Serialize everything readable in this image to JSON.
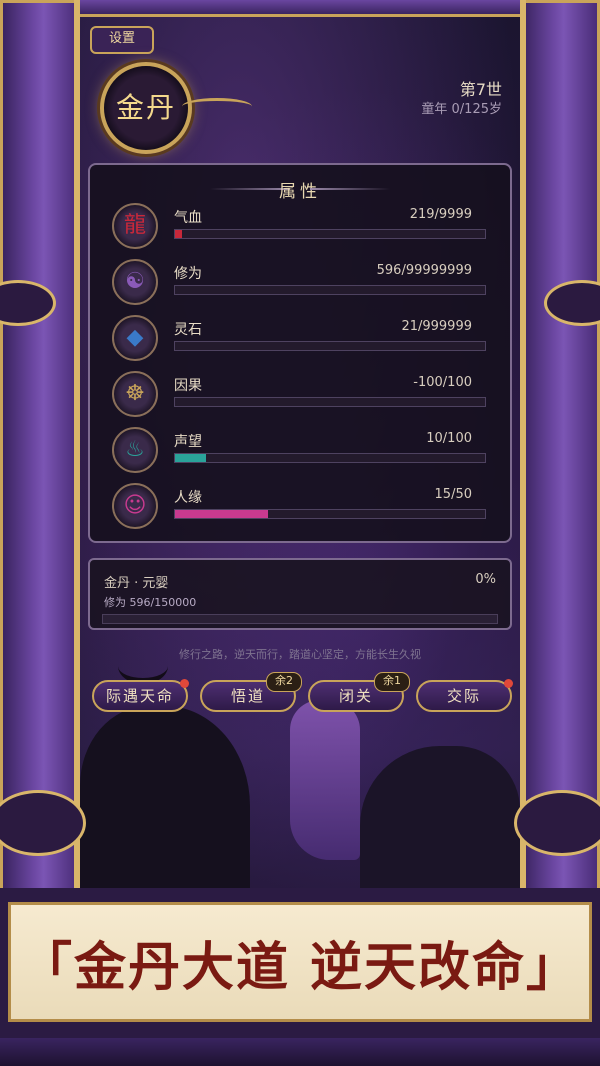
{
  "header": {
    "settings_label": "设置",
    "realm": "金丹",
    "generation": "第7世",
    "age": "童年  0/125岁"
  },
  "attributes": {
    "title": "属性",
    "items": [
      {
        "name": "气血",
        "value": "219/9999",
        "fill": 0.022,
        "color": "#c8283a",
        "icon": "dragon-icon",
        "glyph": "龍"
      },
      {
        "name": "修为",
        "value": "596/99999999",
        "fill": 0.0,
        "color": "#8a5ab8",
        "icon": "meditation-icon",
        "glyph": "☯"
      },
      {
        "name": "灵石",
        "value": "21/999999",
        "fill": 0.0,
        "color": "#3a7ac8",
        "icon": "crystal-icon",
        "glyph": "◆"
      },
      {
        "name": "因果",
        "value": "-100/100",
        "fill": 0.0,
        "color": "#c9a45a",
        "icon": "wheel-icon",
        "glyph": "☸"
      },
      {
        "name": "声望",
        "value": "10/100",
        "fill": 0.1,
        "color": "#2aa39a",
        "icon": "cauldron-icon",
        "glyph": "♨"
      },
      {
        "name": "人缘",
        "value": "15/50",
        "fill": 0.3,
        "color": "#c83a8f",
        "icon": "people-icon",
        "glyph": "☺"
      }
    ]
  },
  "cultivation": {
    "name": "金丹 · 元婴",
    "percent": "0%",
    "xp": "修为 596/150000",
    "fill": 0.0
  },
  "motto": "修行之路，逆天而行，踏道心坚定，方能长生久视",
  "actions": [
    {
      "label": "际遇天命",
      "badge": "",
      "dot": true
    },
    {
      "label": "悟道",
      "badge": "余2",
      "dot": false
    },
    {
      "label": "闭关",
      "badge": "余1",
      "dot": false
    },
    {
      "label": "交际",
      "badge": "",
      "dot": true
    }
  ],
  "banner": {
    "slogan": "「金丹大道 逆天改命」"
  }
}
